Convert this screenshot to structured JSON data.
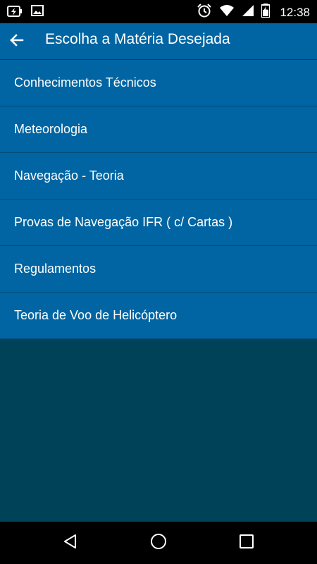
{
  "status_bar": {
    "time": "12:38",
    "icons": [
      "battery-charging-icon",
      "image-icon",
      "alarm-icon",
      "wifi-icon",
      "signal-icon",
      "battery-icon"
    ]
  },
  "app_bar": {
    "title": "Escolha a Matéria Desejada",
    "back_icon": "arrow-left-icon"
  },
  "subjects": [
    {
      "label": "Conhecimentos Técnicos"
    },
    {
      "label": "Meteorologia"
    },
    {
      "label": "Navegação - Teoria"
    },
    {
      "label": "Provas de Navegação IFR ( c/ Cartas )"
    },
    {
      "label": "Regulamentos"
    },
    {
      "label": "Teoria de Voo de Helicóptero"
    }
  ],
  "nav_bar": {
    "icons": [
      "back-triangle-icon",
      "home-circle-icon",
      "recents-square-icon"
    ]
  },
  "colors": {
    "app_bar": "#0065a2",
    "list_item": "#0065a2",
    "divider": "#004b78",
    "background": "#004257",
    "system_bars": "#000000"
  }
}
